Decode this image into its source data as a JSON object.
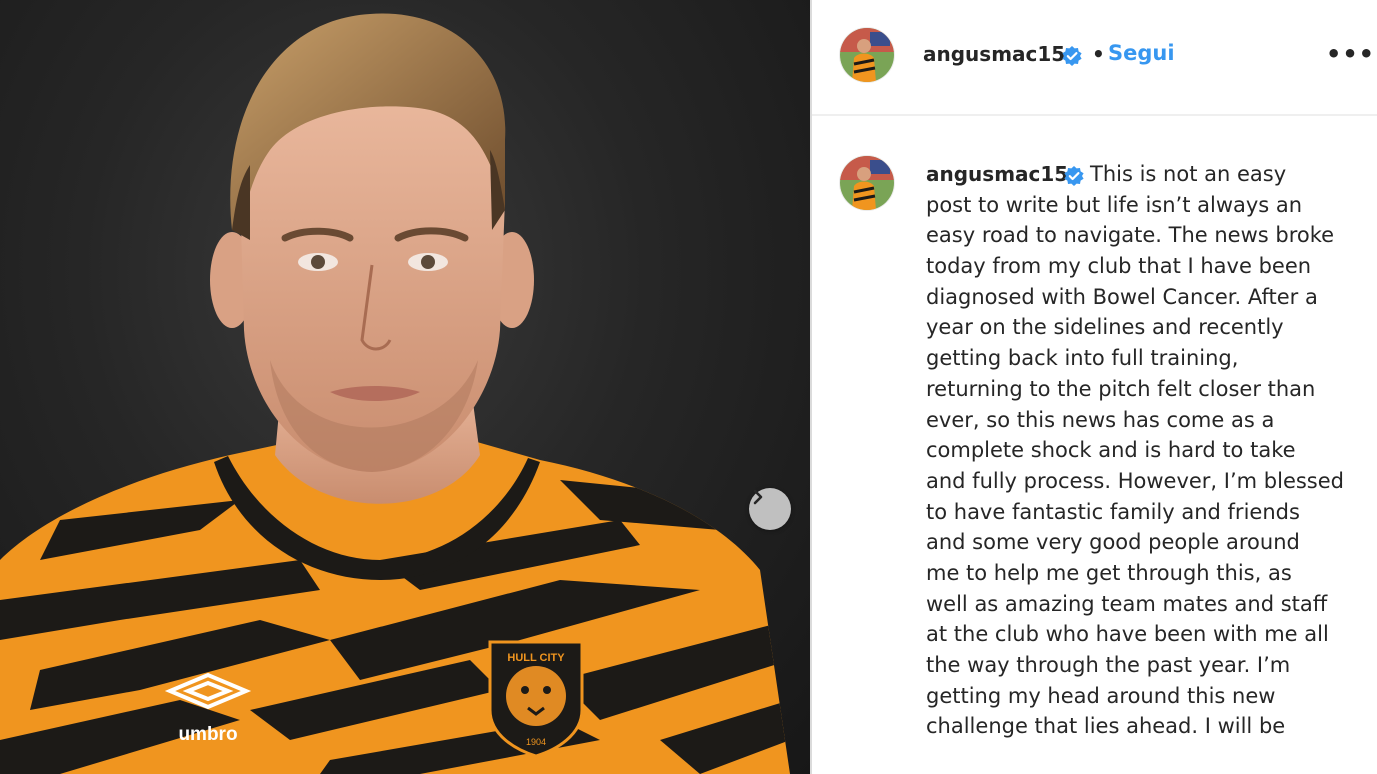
{
  "post": {
    "username": "angusmac15",
    "follow_label": "Segui",
    "separator": "•",
    "more_label": "•••"
  },
  "photo": {
    "brand_text": "umbro",
    "crest_text": "HULL CITY",
    "crest_year": "1904"
  },
  "caption": {
    "username": "angusmac15",
    "lines": [
      "This is not an easy",
      "post to write but life isn’t always an",
      "easy road to navigate. The news broke",
      "today from my club that I have been",
      "diagnosed with Bowel Cancer. After a",
      "year on the sidelines and recently",
      "getting back into full training,",
      "returning to the pitch felt closer than",
      "ever, so this news has come as a",
      "complete shock and is hard to take",
      "and fully process. However, I’m blessed",
      "to have fantastic family and friends",
      "and some very good people around",
      "me to help me get through this, as",
      "well as amazing team mates and staff",
      "at the club who have been with me all",
      "the way through the past year. I’m",
      "getting my head around this new",
      "challenge that lies ahead. I will be"
    ]
  },
  "colors": {
    "link_blue": "#3797f0",
    "verified_blue": "#3897f0",
    "text": "#262626",
    "kit_orange": "#f0951f",
    "kit_black": "#1c1a17"
  },
  "icons": {
    "verified": "verified-badge-icon",
    "next": "chevron-right-icon",
    "more": "more-options-icon"
  }
}
